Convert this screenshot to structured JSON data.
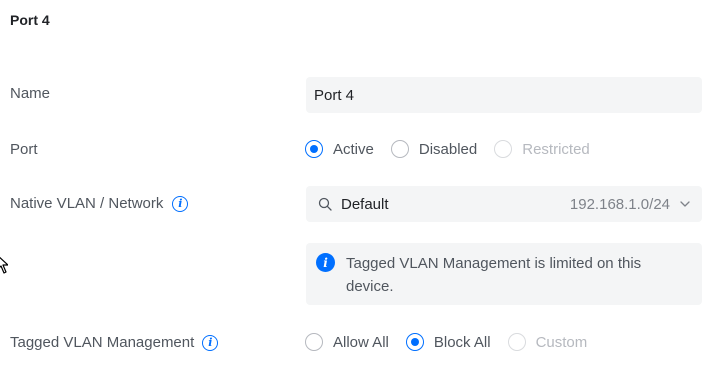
{
  "panel": {
    "title": "Port 4"
  },
  "name_row": {
    "label": "Name",
    "value": "Port 4"
  },
  "port_row": {
    "label": "Port",
    "options": [
      {
        "label": "Active",
        "selected": true,
        "disabled": false
      },
      {
        "label": "Disabled",
        "selected": false,
        "disabled": false
      },
      {
        "label": "Restricted",
        "selected": false,
        "disabled": true
      }
    ]
  },
  "native_vlan_row": {
    "label": "Native VLAN / Network",
    "info_icon": "info-icon",
    "selected_network": "Default",
    "subnet": "192.168.1.0/24",
    "search_icon": "search-icon",
    "dropdown_icon": "chevron-down-icon"
  },
  "notice": {
    "icon": "info-icon",
    "text": "Tagged VLAN Management is limited on this device."
  },
  "tagged_vlan_row": {
    "label": "Tagged VLAN Management",
    "info_icon": "info-icon",
    "options": [
      {
        "label": "Allow All",
        "selected": false,
        "disabled": false
      },
      {
        "label": "Block All",
        "selected": true,
        "disabled": false
      },
      {
        "label": "Custom",
        "selected": false,
        "disabled": true
      }
    ]
  },
  "colors": {
    "accent": "#006fff",
    "field_background": "#f4f5f6",
    "label_text": "#50565e",
    "value_text": "#212327",
    "disabled_text": "#b6b9bf"
  }
}
